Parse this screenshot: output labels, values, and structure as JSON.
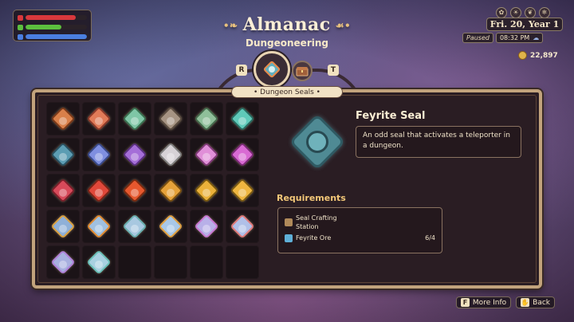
{
  "header": {
    "title": "Almanac",
    "subtitle": "Dungeoneering",
    "tab_left_key": "R",
    "tab_right_key": "T",
    "category_pill": "• Dungeon Seals •"
  },
  "status_bars": [
    {
      "name": "health",
      "fraction": 0.82,
      "color": "#d9383c"
    },
    {
      "name": "stamina",
      "fraction": 0.58,
      "color": "#5cbf3e"
    },
    {
      "name": "mana",
      "fraction": 1.0,
      "color": "#4a7ee0"
    }
  ],
  "calendar": {
    "date": "Fri. 20, Year 1",
    "paused_label": "Paused",
    "time": "08:32 PM",
    "gold": "22,897",
    "season_icons": [
      "flower-icon",
      "sun-icon",
      "leaf-icon",
      "snowflake-icon"
    ]
  },
  "seals": [
    {
      "color": "#d9804a",
      "accent": "#7a3a1a"
    },
    {
      "color": "#e07b58",
      "accent": "#8a3a2a"
    },
    {
      "color": "#7fc6a6",
      "accent": "#3a7050"
    },
    {
      "color": "#a69483",
      "accent": "#5a4c40"
    },
    {
      "color": "#8fbf9a",
      "accent": "#456a4c"
    },
    {
      "color": "#5fcab9",
      "accent": "#2a6a60"
    },
    {
      "color": "#5c9db3",
      "accent": "#2a5060"
    },
    {
      "color": "#7f8fe0",
      "accent": "#3a4a8a"
    },
    {
      "color": "#a56ed8",
      "accent": "#5a3080"
    },
    {
      "color": "#d7d2d6",
      "accent": "#808080"
    },
    {
      "color": "#e08fd8",
      "accent": "#803a78"
    },
    {
      "color": "#d96ad3",
      "accent": "#7a2a75"
    },
    {
      "color": "#d74a5a",
      "accent": "#7a1f2a"
    },
    {
      "color": "#e0483a",
      "accent": "#7a2418"
    },
    {
      "color": "#e6582e",
      "accent": "#7a2a10"
    },
    {
      "color": "#e5a23a",
      "accent": "#7a5010"
    },
    {
      "color": "#eab13a",
      "accent": "#7a5a10"
    },
    {
      "color": "#efb640",
      "accent": "#7a5a14"
    },
    {
      "color": "#8fb0d8",
      "accent": "#d9a040"
    },
    {
      "color": "#9fc0e0",
      "accent": "#e08a30"
    },
    {
      "color": "#a8c8e0",
      "accent": "#6ab0b0"
    },
    {
      "color": "#a8c8e8",
      "accent": "#e0a040"
    },
    {
      "color": "#b8b0e8",
      "accent": "#c878d0"
    },
    {
      "color": "#b0c0e8",
      "accent": "#e07a7a"
    },
    {
      "color": "#a8b0e0",
      "accent": "#b080d8"
    },
    {
      "color": "#a8d0e0",
      "accent": "#6ac0b8"
    }
  ],
  "empty_slots": 4,
  "selected": {
    "name": "Feyrite Seal",
    "description": "An odd seal that activates a teleporter in a dungeon.",
    "requirements_title": "Requirements",
    "requirements": [
      {
        "label": "Seal Crafting Station",
        "count": "",
        "icon": "workbench-icon",
        "color": "#b08a5a"
      },
      {
        "label": "Feyrite Ore",
        "count": "6/4",
        "icon": "ore-icon",
        "color": "#5fb0d8"
      }
    ]
  },
  "hints": [
    {
      "key": "F",
      "label": "More Info"
    },
    {
      "key": "✋",
      "label": "Back"
    }
  ]
}
